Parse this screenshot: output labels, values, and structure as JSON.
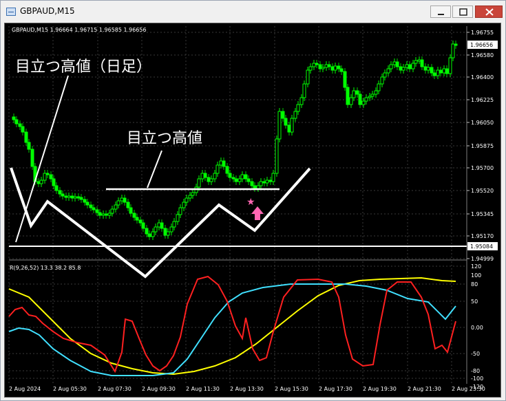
{
  "window": {
    "title": "GBPAUD,M15",
    "minimize_label": "",
    "maximize_label": "",
    "close_label": ""
  },
  "chart": {
    "header_text": "GBPAUD,M15  1.96664 1.96715 1.96585 1.96656",
    "current_price": "1.96656",
    "line_price": "1.95084",
    "price_ticks": [
      "1.96755",
      "1.96580",
      "1.96400",
      "1.96225",
      "1.96050",
      "1.95875",
      "1.95700",
      "1.95520",
      "1.95345",
      "1.95170",
      "1.94999"
    ],
    "time_ticks": [
      "2 Aug 2024",
      "2 Aug 05:30",
      "2 Aug 07:30",
      "2 Aug 09:30",
      "2 Aug 11:30",
      "2 Aug 13:30",
      "2 Aug 15:30",
      "2 Aug 17:30",
      "2 Aug 19:30",
      "2 Aug 21:30",
      "2 Aug 23:30"
    ],
    "annotation_daily": "目立つ高値（日足）",
    "annotation_m15": "目立つ高値",
    "colors": {
      "bull": "#00ff00",
      "bear": "#00cc00",
      "annotation": "#ffffff",
      "star": "#ff66b2"
    }
  },
  "indicator": {
    "header_text": "R(9,26,52) 13.3 38.2 85.8",
    "ticks": [
      "120",
      "100",
      "80",
      "50",
      "0.00",
      "-50",
      "-80",
      "-100",
      "-120"
    ],
    "colors": {
      "red": "#ff2020",
      "cyan": "#40e0ff",
      "yellow": "#ffff00"
    }
  }
}
